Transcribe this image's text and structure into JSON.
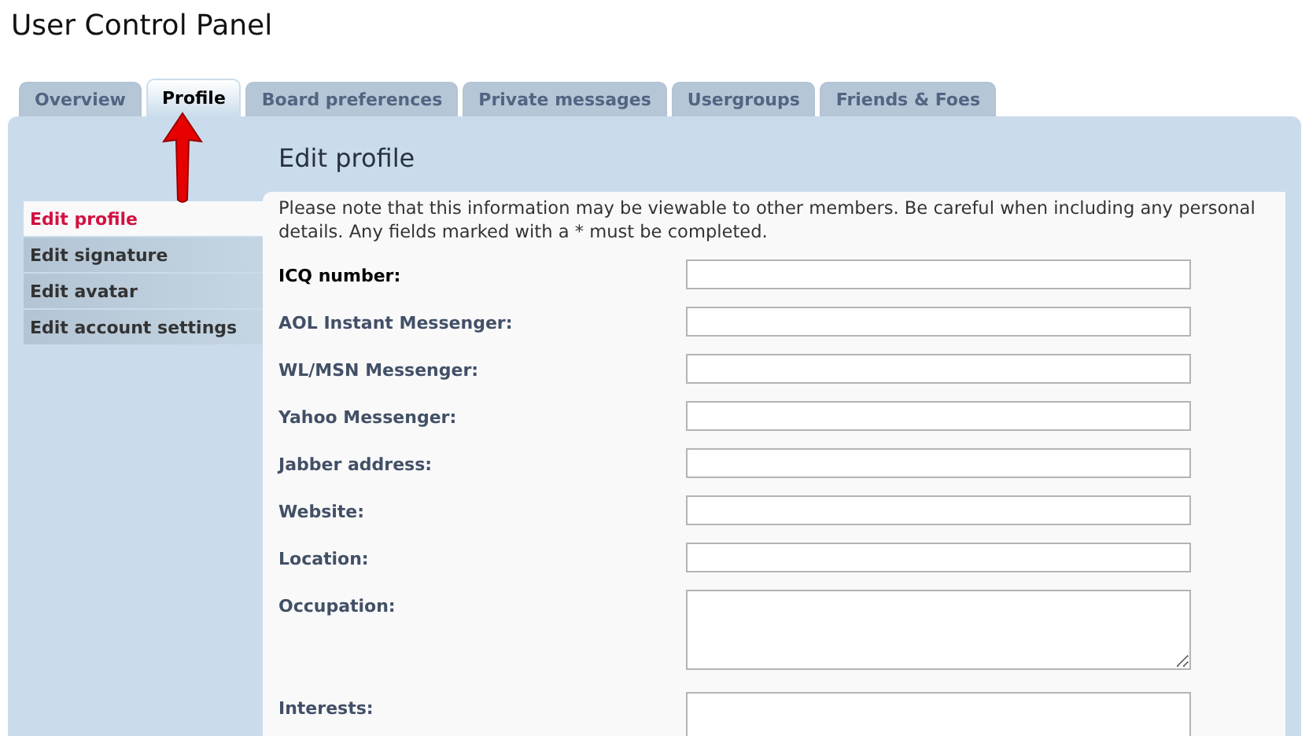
{
  "page_title": "User Control Panel",
  "tabs": [
    {
      "label": "Overview",
      "selected": false
    },
    {
      "label": "Profile",
      "selected": true
    },
    {
      "label": "Board preferences",
      "selected": false
    },
    {
      "label": "Private messages",
      "selected": false
    },
    {
      "label": "Usergroups",
      "selected": false
    },
    {
      "label": "Friends & Foes",
      "selected": false
    }
  ],
  "sidebar": {
    "items": [
      {
        "label": "Edit profile",
        "selected": true
      },
      {
        "label": "Edit signature",
        "selected": false
      },
      {
        "label": "Edit avatar",
        "selected": false
      },
      {
        "label": "Edit account settings",
        "selected": false
      }
    ]
  },
  "content": {
    "heading": "Edit profile",
    "notice": "Please note that this information may be viewable to other members. Be careful when including any personal details. Any fields marked with a * must be completed.",
    "fields": [
      {
        "label": "ICQ number:",
        "kind": "input",
        "highlighted": true
      },
      {
        "label": "AOL Instant Messenger:",
        "kind": "input",
        "highlighted": false
      },
      {
        "label": "WL/MSN Messenger:",
        "kind": "input",
        "highlighted": false
      },
      {
        "label": "Yahoo Messenger:",
        "kind": "input",
        "highlighted": false
      },
      {
        "label": "Jabber address:",
        "kind": "input",
        "highlighted": false
      },
      {
        "label": "Website:",
        "kind": "input",
        "highlighted": false
      },
      {
        "label": "Location:",
        "kind": "input",
        "highlighted": false
      },
      {
        "label": "Occupation:",
        "kind": "textarea",
        "highlighted": false
      },
      {
        "label": "Interests:",
        "kind": "textarea",
        "highlighted": false
      }
    ]
  }
}
